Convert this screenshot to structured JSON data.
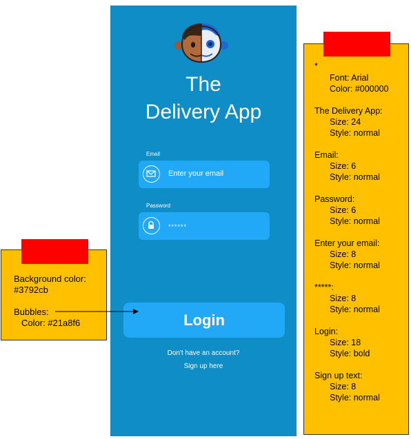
{
  "app": {
    "title_line1": "The",
    "title_line2": "Delivery App",
    "email_label": "Email",
    "email_placeholder": "Enter your email",
    "password_label": "Password",
    "password_value": "******",
    "login_label": "Login",
    "signup_question": "Don't have an account?",
    "signup_link": "Sign up here",
    "colors": {
      "background": "#3792cb",
      "bubbles": "#21a8f6",
      "text": "#ffffff"
    }
  },
  "left_note": {
    "lines": [
      "Background color:",
      "#3792cb",
      "",
      "Bubbles:",
      "Color: #21a8f6"
    ]
  },
  "right_note": {
    "lines": [
      "*",
      "Font: Arial",
      "Color: #000000",
      "The Delivery App:",
      "Size: 24",
      "Style: normal",
      "Email:",
      "Size: 6",
      "Style: normal",
      "Password:",
      "Size: 6",
      "Style: normal",
      "Enter your email:",
      "Size: 8",
      "Style: normal",
      "*****:",
      "Size: 8",
      "Style: normal",
      "Login:",
      "Size: 18",
      "Style: bold",
      "Sign up text:",
      "Size: 8",
      "Style: normal"
    ]
  }
}
